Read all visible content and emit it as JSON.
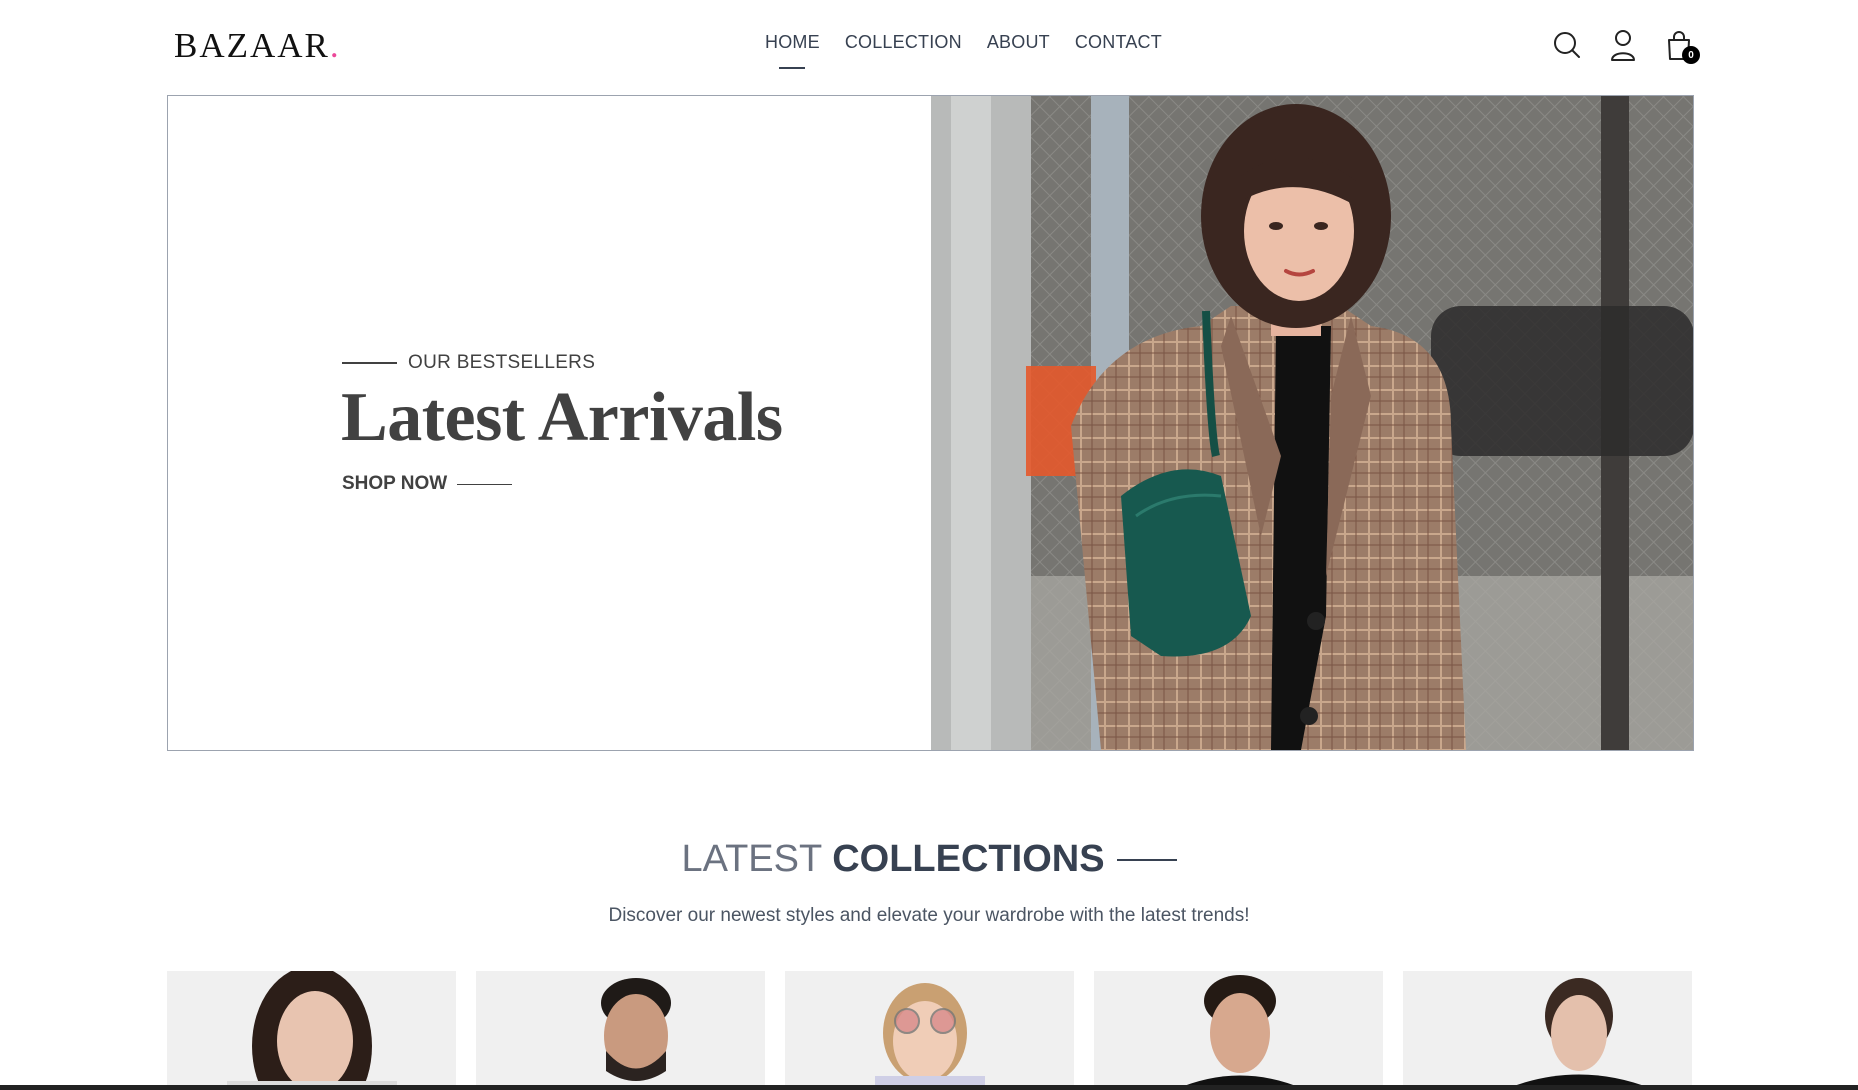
{
  "header": {
    "logo_text": "BAZAAR",
    "logo_dot": ".",
    "nav": [
      {
        "label": "HOME",
        "active": true
      },
      {
        "label": "COLLECTION",
        "active": false
      },
      {
        "label": "ABOUT",
        "active": false
      },
      {
        "label": "CONTACT",
        "active": false
      }
    ],
    "icons": [
      "search-icon",
      "user-icon",
      "cart-icon"
    ],
    "cart_count": "0"
  },
  "hero": {
    "eyebrow": "OUR BESTSELLERS",
    "title": "Latest Arrivals",
    "cta": "SHOP NOW"
  },
  "collections": {
    "title_light": "LATEST",
    "title_bold": "COLLECTIONS",
    "subtitle": "Discover our newest styles and elevate your wardrobe with the latest trends!"
  },
  "colors": {
    "accent_dot": "#ec4899",
    "text_dark": "#374151",
    "card_bg": "#f0f0f0"
  }
}
